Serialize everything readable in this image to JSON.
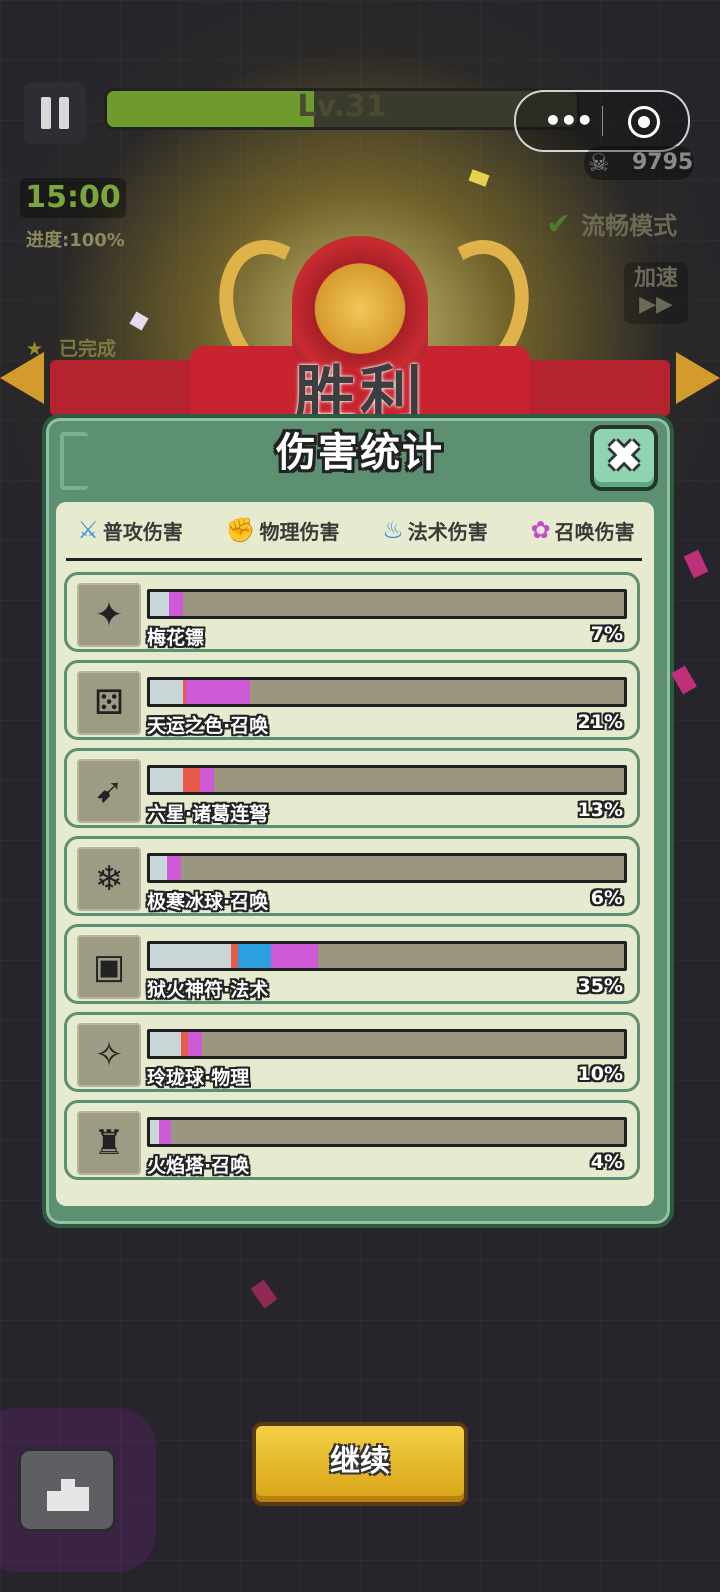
{
  "hud": {
    "level": "Lv.31",
    "level_progress": 0.44,
    "kills": "9795",
    "timer": "15:00",
    "progress": "进度:100%",
    "smooth_mode": "流畅模式",
    "speed_label": "加速",
    "speed_icon": "▶▶",
    "completed": "已完成",
    "completed_icon": "star-icon"
  },
  "miniapp": {
    "menu_icon": "more-dots-icon",
    "close_icon": "target-icon"
  },
  "victory": {
    "title": "胜利"
  },
  "panel": {
    "title": "伤害统计",
    "close_icon": "close-icon",
    "legend": [
      {
        "label": "普攻伤害",
        "icon": "sword-icon",
        "color": "#c9d6d8"
      },
      {
        "label": "物理伤害",
        "icon": "fist-icon",
        "color": "#e85a4a"
      },
      {
        "label": "法术伤害",
        "icon": "flame-icon",
        "color": "#2b9fe0"
      },
      {
        "label": "召唤伤害",
        "icon": "paw-icon",
        "color": "#cf5ad8"
      }
    ],
    "rows": [
      {
        "name": "梅花镖",
        "pct": "7%",
        "icon": "shuriken-icon",
        "segments": [
          4,
          0,
          0,
          3
        ]
      },
      {
        "name": "天运之色·召唤",
        "pct": "21%",
        "icon": "dice-icon",
        "segments": [
          7,
          0.5,
          0,
          13.5
        ]
      },
      {
        "name": "六星·诸葛连弩",
        "pct": "13%",
        "icon": "crossbow-icon",
        "segments": [
          7,
          3.5,
          0,
          3
        ]
      },
      {
        "name": "极寒冰球·召唤",
        "pct": "6%",
        "icon": "ice-ball-icon",
        "segments": [
          3.5,
          0,
          0,
          3
        ]
      },
      {
        "name": "狱火神符·法术",
        "pct": "35%",
        "icon": "rune-icon",
        "segments": [
          17,
          1.5,
          7,
          10
        ]
      },
      {
        "name": "玲珑球·物理",
        "pct": "10%",
        "icon": "orb-icon",
        "segments": [
          6.5,
          1.5,
          0,
          3
        ]
      },
      {
        "name": "火焰塔·召唤",
        "pct": "4%",
        "icon": "fire-tower-icon",
        "segments": [
          2,
          0,
          0,
          2.5
        ]
      }
    ]
  },
  "footer": {
    "continue_label": "继续",
    "stats_icon": "leaderboard-icon"
  }
}
